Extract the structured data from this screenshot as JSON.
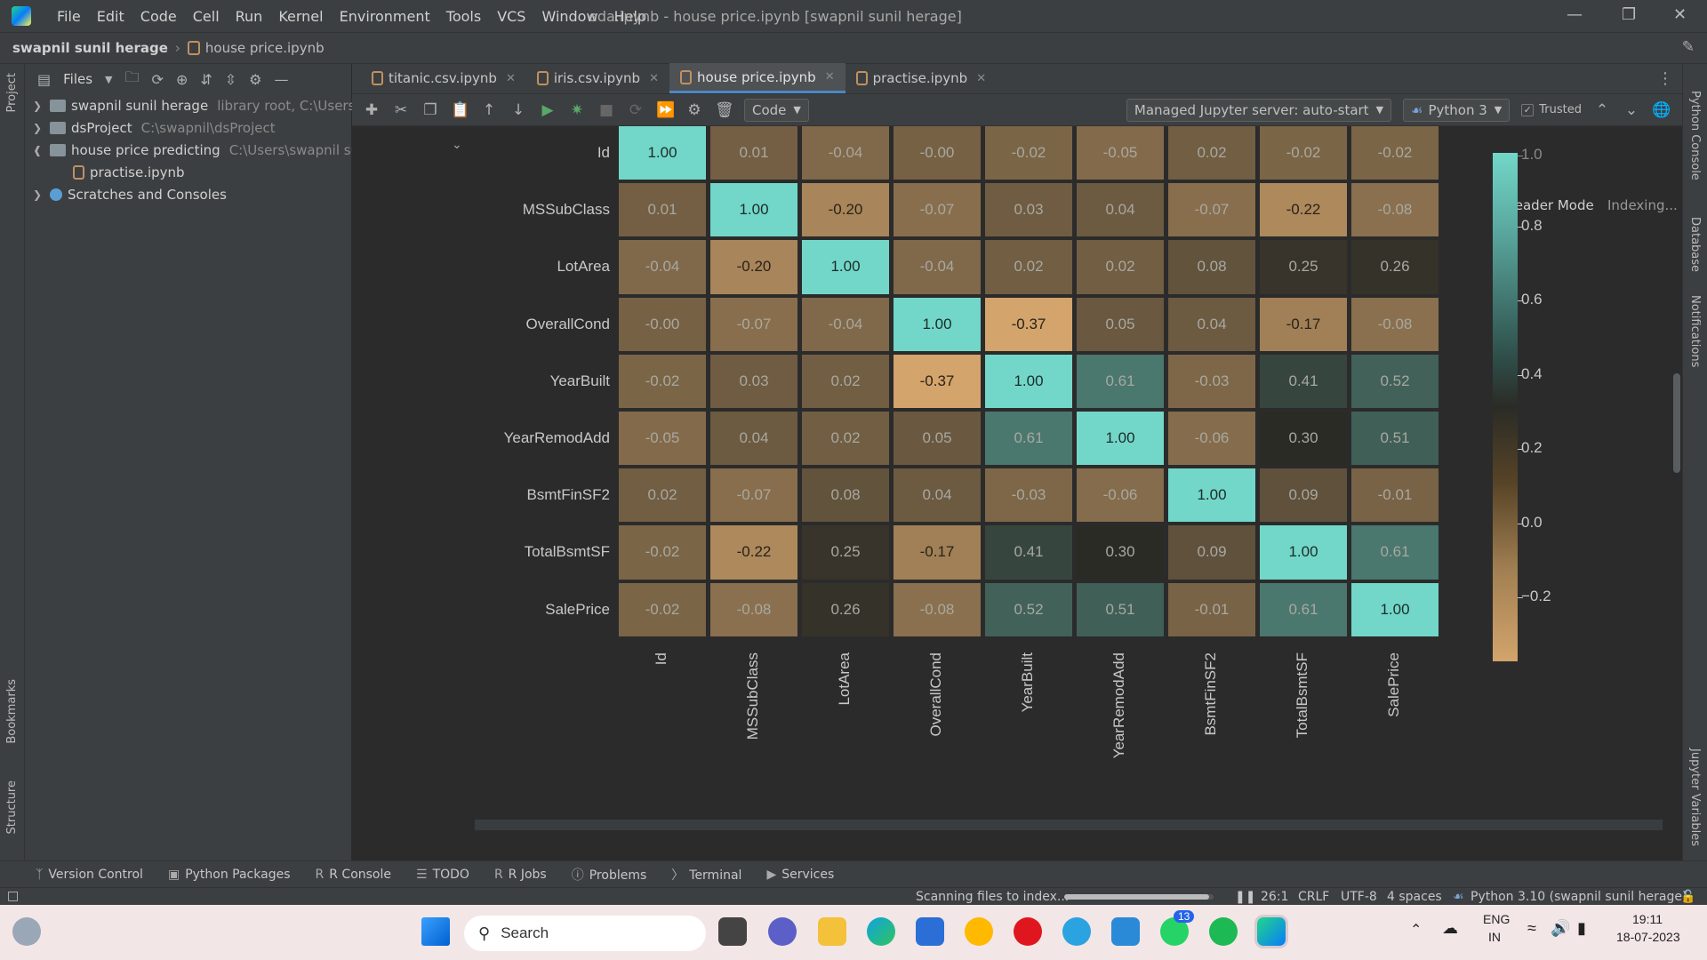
{
  "window": {
    "title": "eda.ipynb - house price.ipynb [swapnil sunil herage]",
    "menu": [
      "File",
      "Edit",
      "Code",
      "Cell",
      "Run",
      "Kernel",
      "Environment",
      "Tools",
      "VCS",
      "Window",
      "Help"
    ]
  },
  "breadcrumb": {
    "project": "swapnil sunil herage",
    "file": "house price.ipynb"
  },
  "project_panel": {
    "view_label": "Files",
    "tree": [
      {
        "name": "swapnil sunil herage",
        "detail": "library root, C:\\Users\\swa",
        "expanded": false,
        "indent": 0,
        "kind": "folder"
      },
      {
        "name": "dsProject",
        "detail": "C:\\swapnil\\dsProject",
        "expanded": false,
        "indent": 0,
        "kind": "folder"
      },
      {
        "name": "house price predicting",
        "detail": "C:\\Users\\swapnil sunil h",
        "expanded": true,
        "indent": 0,
        "kind": "folder"
      },
      {
        "name": "practise.ipynb",
        "detail": "",
        "expanded": false,
        "indent": 1,
        "kind": "notebook"
      },
      {
        "name": "Scratches and Consoles",
        "detail": "",
        "expanded": false,
        "indent": 0,
        "kind": "scratch"
      }
    ]
  },
  "left_strip": {
    "project": "Project",
    "bookmarks": "Bookmarks",
    "structure": "Structure"
  },
  "right_strip": {
    "python_console": "Python Console",
    "database": "Database",
    "notifications": "Notifications",
    "jupyter_variables": "Jupyter Variables"
  },
  "tabs": [
    {
      "label": "titanic.csv.ipynb",
      "active": false
    },
    {
      "label": "iris.csv.ipynb",
      "active": false
    },
    {
      "label": "house price.ipynb",
      "active": true
    },
    {
      "label": "practise.ipynb",
      "active": false
    }
  ],
  "nb_toolbar": {
    "cell_type": "Code",
    "server": "Managed Jupyter server: auto-start",
    "kernel": "Python 3",
    "trusted": "Trusted"
  },
  "editor": {
    "reader_mode": "Reader Mode",
    "indexing": "Indexing..."
  },
  "chart_data": {
    "type": "heatmap",
    "title": "",
    "labels": [
      "Id",
      "MSSubClass",
      "LotArea",
      "OverallCond",
      "YearBuilt",
      "YearRemodAdd",
      "BsmtFinSF2",
      "TotalBsmtSF",
      "SalePrice"
    ],
    "matrix": [
      [
        "1.00",
        "0.01",
        "-0.04",
        "-0.00",
        "-0.02",
        "-0.05",
        "0.02",
        "-0.02",
        "-0.02"
      ],
      [
        "0.01",
        "1.00",
        "-0.20",
        "-0.07",
        "0.03",
        "0.04",
        "-0.07",
        "-0.22",
        "-0.08"
      ],
      [
        "-0.04",
        "-0.20",
        "1.00",
        "-0.04",
        "0.02",
        "0.02",
        "0.08",
        "0.25",
        "0.26"
      ],
      [
        "-0.00",
        "-0.07",
        "-0.04",
        "1.00",
        "-0.37",
        "0.05",
        "0.04",
        "-0.17",
        "-0.08"
      ],
      [
        "-0.02",
        "0.03",
        "0.02",
        "-0.37",
        "1.00",
        "0.61",
        "-0.03",
        "0.41",
        "0.52"
      ],
      [
        "-0.05",
        "0.04",
        "0.02",
        "0.05",
        "0.61",
        "1.00",
        "-0.06",
        "0.30",
        "0.51"
      ],
      [
        "0.02",
        "-0.07",
        "0.08",
        "0.04",
        "-0.03",
        "-0.06",
        "1.00",
        "0.09",
        "-0.01"
      ],
      [
        "-0.02",
        "-0.22",
        "0.25",
        "-0.17",
        "0.41",
        "0.30",
        "0.09",
        "1.00",
        "0.61"
      ],
      [
        "-0.02",
        "-0.08",
        "0.26",
        "-0.08",
        "0.52",
        "0.51",
        "-0.01",
        "0.61",
        "1.00"
      ]
    ],
    "colorbar_ticks": [
      "1.0",
      "0.8",
      "0.6",
      "0.4",
      "0.2",
      "0.0",
      "−0.2"
    ],
    "colorbar_range": [
      -0.37,
      1.0
    ],
    "colors": {
      "low": "#d3a46c",
      "mid": "#2b2b26",
      "high": "#72d7c8"
    }
  },
  "bottom_tabs": [
    "Version Control",
    "Python Packages",
    "R Console",
    "TODO",
    "R Jobs",
    "Problems",
    "Terminal",
    "Services"
  ],
  "status": {
    "scanning": "Scanning files to index...",
    "position": "26:1",
    "line_sep": "CRLF",
    "encoding": "UTF-8",
    "indent": "4 spaces",
    "interpreter": "Python 3.10 (swapnil sunil herage)",
    "progress": 0.97
  },
  "taskbar": {
    "search_placeholder": "Search",
    "whatsapp_badge": "13",
    "lang_line1": "ENG",
    "lang_line2": "IN",
    "time": "19:11",
    "date": "18-07-2023"
  }
}
